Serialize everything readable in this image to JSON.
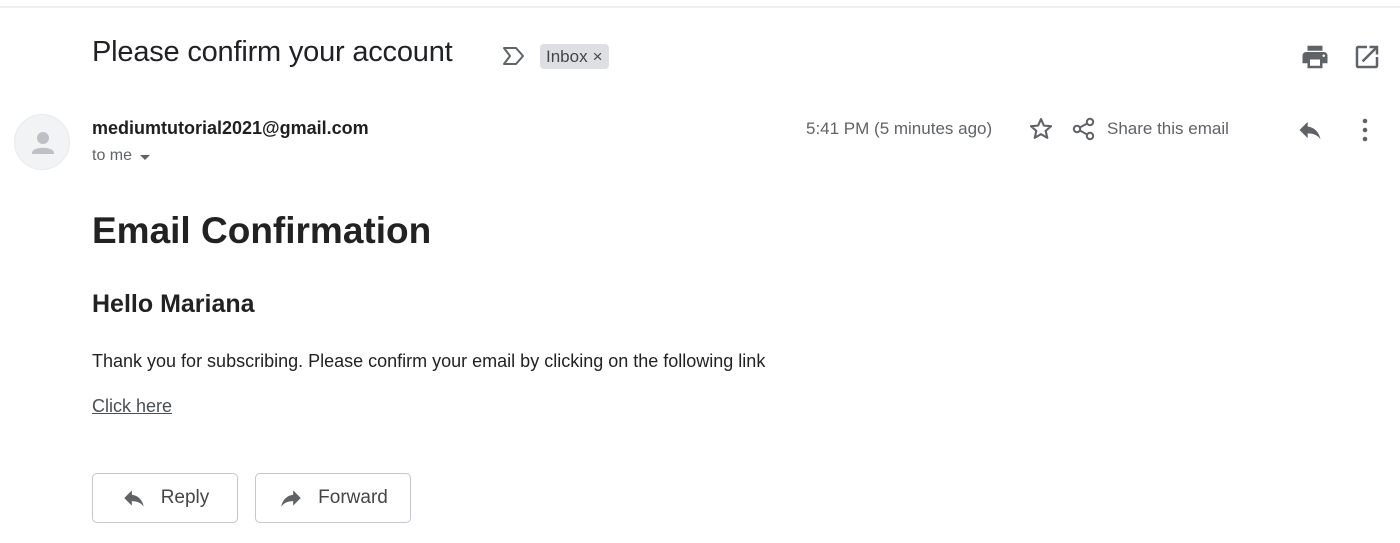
{
  "message": {
    "subject": "Please confirm your account",
    "label": "Inbox",
    "label_remove": "×",
    "sender": "mediumtutorial2021@gmail.com",
    "recipient_line": "to me",
    "timestamp": "5:41 PM (5 minutes ago)",
    "share_label": "Share this email"
  },
  "body": {
    "heading": "Email Confirmation",
    "greeting": "Hello Mariana",
    "paragraph": "Thank you for subscribing. Please confirm your email by clicking on the following link",
    "link_text": "Click here"
  },
  "actions": {
    "reply_label": "Reply",
    "forward_label": "Forward"
  },
  "icons": {
    "importance": "importance-marker-icon",
    "print": "print-icon",
    "popout": "open-in-new-window-icon",
    "avatar": "default-avatar-icon",
    "star": "star-icon",
    "share": "share-icon",
    "reply": "reply-icon",
    "more": "more-vertical-icon",
    "forward": "forward-icon"
  },
  "colors": {
    "text_primary": "#202124",
    "text_secondary": "#5f6368",
    "chip_bg": "#dddfe3",
    "icon_gray": "#5f6368",
    "button_border": "#c4c7cc"
  }
}
